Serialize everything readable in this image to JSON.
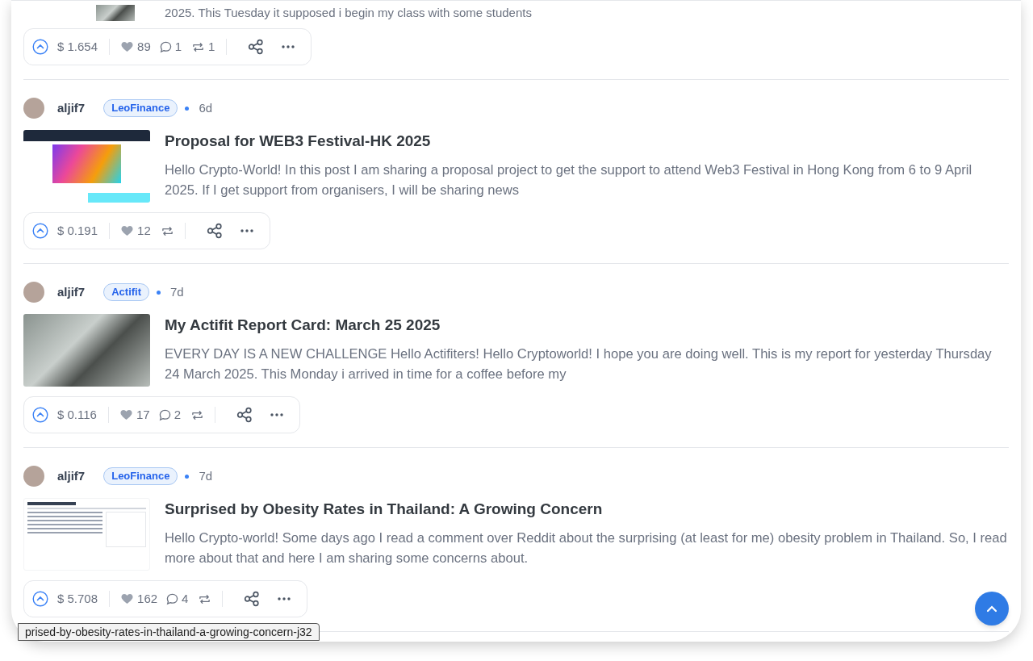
{
  "feed": [
    {
      "kind": "cut_off",
      "thumbnail": {
        "kind": "photo"
      },
      "excerpt": "2025. This Tuesday it supposed i begin my class with some students",
      "stats": {
        "payout": "$ 1.654",
        "likes": "89",
        "comments": "1",
        "reblogs": "1"
      }
    },
    {
      "kind": "post",
      "author": "aljif7",
      "community": "LeoFinance",
      "time": "6d",
      "thumbnail": {
        "kind": "webpage"
      },
      "title": "Proposal for WEB3 Festival-HK 2025",
      "excerpt": "Hello Crypto-World! In this post I am sharing a proposal project to get the support to attend Web3 Festival in Hong Kong from 6 to 9 April 2025. If I get support from organisers, I will be sharing news",
      "stats": {
        "payout": "$ 0.191",
        "likes": "12"
      }
    },
    {
      "kind": "post",
      "author": "aljif7",
      "community": "Actifit",
      "time": "7d",
      "thumbnail": {
        "kind": "photo"
      },
      "title": "My Actifit Report Card: March 25 2025",
      "excerpt": "EVERY DAY IS A NEW CHALLENGE Hello Actifiters! Hello Cryptoworld! I hope you are doing well. This is my report for yesterday Thursday 24 March 2025. This Monday i arrived in time for a coffee before my",
      "stats": {
        "payout": "$ 0.116",
        "likes": "17",
        "comments": "2"
      }
    },
    {
      "kind": "post",
      "author": "aljif7",
      "community": "LeoFinance",
      "time": "7d",
      "thumbnail": {
        "kind": "document"
      },
      "title": "Surprised by Obesity Rates in Thailand: A Growing Concern",
      "excerpt": "Hello Crypto-world! Some days ago I read a comment over Reddit about the surprising (at least for me) obesity problem in Thailand. So, I read more about that and here I am sharing some concerns about.",
      "stats": {
        "payout": "$ 5.708",
        "likes": "162",
        "comments": "4"
      }
    }
  ],
  "status_url": "prised-by-obesity-rates-in-thailand-a-growing-concern-j32"
}
